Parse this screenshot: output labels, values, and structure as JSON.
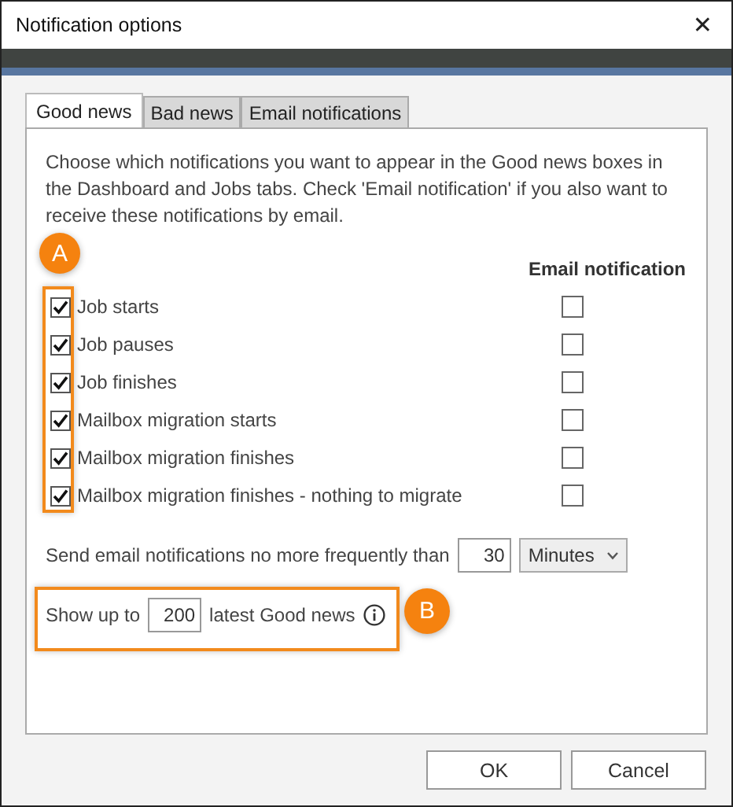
{
  "window": {
    "title": "Notification options",
    "close": "✕"
  },
  "tabs": [
    {
      "label": "Good news",
      "selected": true
    },
    {
      "label": "Bad news",
      "selected": false
    },
    {
      "label": "Email notifications",
      "selected": false
    }
  ],
  "intro": "Choose which notifications you want to appear in the Good news boxes in the Dashboard and Jobs tabs. Check 'Email notification' if you also want to receive these notifications by email.",
  "email_header": "Email notification",
  "notifications": [
    {
      "label": "Job starts",
      "checked": true,
      "email": false
    },
    {
      "label": "Job pauses",
      "checked": true,
      "email": false
    },
    {
      "label": "Job finishes",
      "checked": true,
      "email": false
    },
    {
      "label": "Mailbox migration starts",
      "checked": true,
      "email": false
    },
    {
      "label": "Mailbox migration finishes",
      "checked": true,
      "email": false
    },
    {
      "label": "Mailbox migration finishes - nothing to migrate",
      "checked": true,
      "email": false
    }
  ],
  "frequency": {
    "label": "Send email notifications no more frequently than",
    "value": "30",
    "unit": "Minutes"
  },
  "show": {
    "before": "Show up to",
    "value": "200",
    "after": "latest Good news"
  },
  "annotations": [
    {
      "label": "A"
    },
    {
      "label": "B"
    }
  ],
  "buttons": [
    "OK",
    "Cancel"
  ]
}
